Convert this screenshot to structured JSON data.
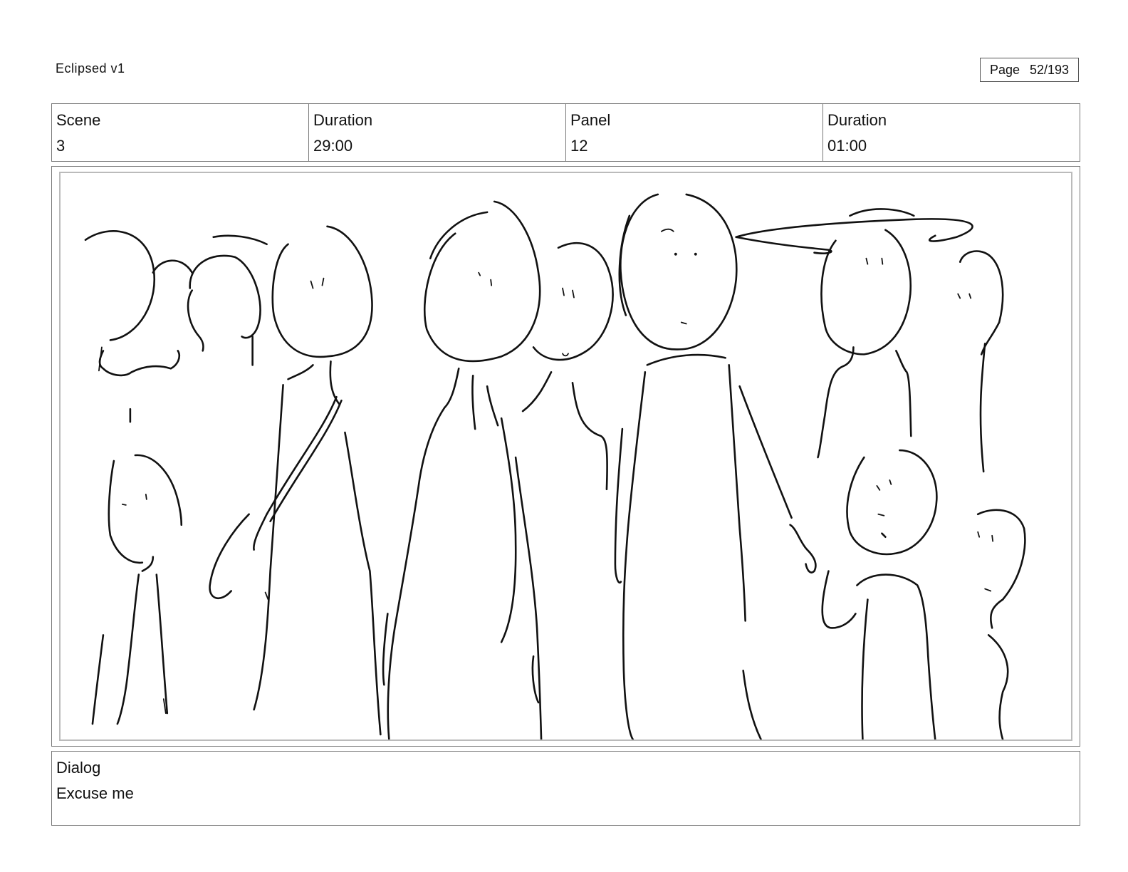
{
  "header": {
    "title": "Eclipsed v1",
    "page_label": "Page",
    "page_value": "52/193"
  },
  "info": [
    {
      "label": "Scene",
      "value": "3"
    },
    {
      "label": "Duration",
      "value": "29:00"
    },
    {
      "label": "Panel",
      "value": "12"
    },
    {
      "label": "Duration",
      "value": "01:00"
    }
  ],
  "panel": {
    "image_icon": "storyboard-sketch-crowd"
  },
  "dialog": {
    "label": "Dialog",
    "text": "Excuse me"
  }
}
